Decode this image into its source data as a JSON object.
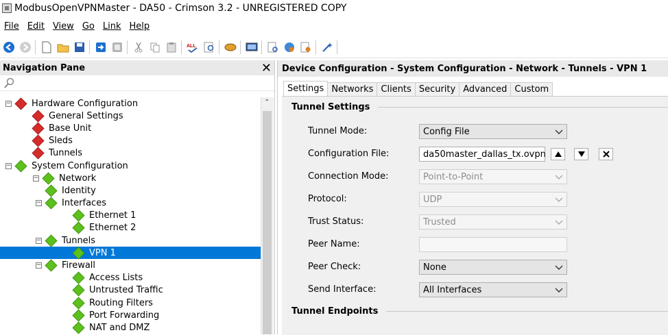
{
  "window": {
    "title": "ModbusOpenVPNMaster - DA50 - Crimson 3.2 - UNREGISTERED COPY"
  },
  "menu": [
    {
      "label": "File"
    },
    {
      "label": "Edit"
    },
    {
      "label": "View"
    },
    {
      "label": "Go"
    },
    {
      "label": "Link"
    },
    {
      "label": "Help"
    }
  ],
  "toolbar": {
    "icons": [
      "back-icon",
      "forward-icon",
      "new-file-icon",
      "open-folder-icon",
      "save-icon",
      "blue-arrow-icon",
      "gray-box-icon",
      "cut-icon",
      "copy-icon",
      "paste-icon",
      "spell-check-icon",
      "find-icon",
      "handshake-icon",
      "monitor-icon",
      "document-search-icon",
      "globe-gear-icon",
      "find-in-folder-icon",
      "wand-icon"
    ]
  },
  "nav": {
    "title": "Navigation Pane",
    "close_label": "✕",
    "tree": [
      {
        "label": "Hardware Configuration",
        "level": 0,
        "color": "red",
        "exp": "minus"
      },
      {
        "label": "General Settings",
        "level": 1,
        "color": "red"
      },
      {
        "label": "Base Unit",
        "level": 1,
        "color": "red"
      },
      {
        "label": "Sleds",
        "level": 1,
        "color": "red"
      },
      {
        "label": "Tunnels",
        "level": 1,
        "color": "red"
      },
      {
        "label": "System Configuration",
        "level": 0,
        "color": "green",
        "exp": "minus"
      },
      {
        "label": "Network",
        "level": 1,
        "color": "green",
        "exp": "minus"
      },
      {
        "label": "Identity",
        "level": 2,
        "color": "green"
      },
      {
        "label": "Interfaces",
        "level": 2,
        "color": "green",
        "exp": "minus"
      },
      {
        "label": "Ethernet 1",
        "level": 3,
        "color": "green"
      },
      {
        "label": "Ethernet 2",
        "level": 3,
        "color": "green"
      },
      {
        "label": "Tunnels",
        "level": 2,
        "color": "green",
        "exp": "minus"
      },
      {
        "label": "VPN 1",
        "level": 3,
        "color": "green",
        "selected": true
      },
      {
        "label": "Firewall",
        "level": 2,
        "color": "green",
        "exp": "minus"
      },
      {
        "label": "Access Lists",
        "level": 3,
        "color": "green"
      },
      {
        "label": "Untrusted Traffic",
        "level": 3,
        "color": "green"
      },
      {
        "label": "Routing Filters",
        "level": 3,
        "color": "green"
      },
      {
        "label": "Port Forwarding",
        "level": 3,
        "color": "green"
      },
      {
        "label": "NAT and DMZ",
        "level": 3,
        "color": "green"
      }
    ]
  },
  "content": {
    "breadcrumb": "Device Configuration - System Configuration - Network - Tunnels - VPN 1",
    "tabs": [
      {
        "label": "Settings",
        "active": true
      },
      {
        "label": "Networks"
      },
      {
        "label": "Clients"
      },
      {
        "label": "Security"
      },
      {
        "label": "Advanced"
      },
      {
        "label": "Custom"
      }
    ],
    "groups": {
      "tunnel_settings": "Tunnel Settings",
      "tunnel_endpoints": "Tunnel Endpoints"
    },
    "fields": {
      "tunnel_mode": {
        "label": "Tunnel Mode:",
        "value": "Config File"
      },
      "config_file": {
        "label": "Configuration File:",
        "value": "da50master_dallas_tx.ovpn"
      },
      "connection_mode": {
        "label": "Connection Mode:",
        "value": "Point-to-Point"
      },
      "protocol": {
        "label": "Protocol:",
        "value": "UDP"
      },
      "trust_status": {
        "label": "Trust Status:",
        "value": "Trusted"
      },
      "peer_name": {
        "label": "Peer Name:",
        "value": ""
      },
      "peer_check": {
        "label": "Peer Check:",
        "value": "None"
      },
      "send_interface": {
        "label": "Send Interface:",
        "value": "All Interfaces"
      }
    }
  },
  "colors": {
    "selection": "#0078d7",
    "red_node": "#d62b2b",
    "green_node": "#5cc11c"
  }
}
